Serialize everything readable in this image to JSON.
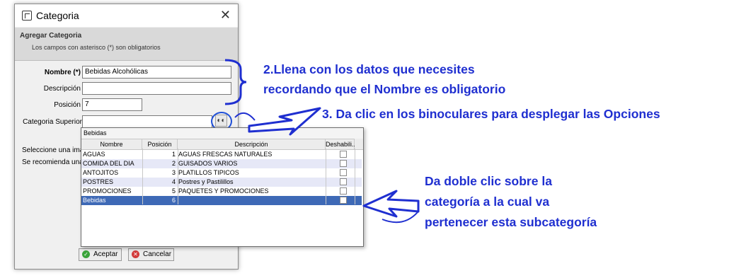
{
  "dialog": {
    "title": "Categoria",
    "close_glyph": "✕",
    "section_title": "Agregar Categoria",
    "section_sub": "Los campos con asterisco (*) son obligatorios",
    "fields": {
      "nombre_label": "Nombre (*)",
      "nombre_value": "Bebidas Alcohólicas",
      "descripcion_label": "Descripción",
      "descripcion_value": "",
      "posicion_label": "Posición",
      "posicion_value": "7",
      "categoria_label": "Categoria Superior",
      "categoria_value": ""
    },
    "side_text_1": "Seleccione una ima",
    "side_text_2": "Se recomienda una",
    "buttons": {
      "accept": "Aceptar",
      "cancel": "Cancelar"
    },
    "binoculars_icon": "binoculars-icon"
  },
  "popup": {
    "header": "Bebidas",
    "columns": [
      "Nombre",
      "Posición",
      "Descripción",
      "Deshabili..."
    ],
    "rows": [
      {
        "nombre": "AGUAS",
        "posicion": "1",
        "descripcion": "AGUAS FRESCAS NATURALES"
      },
      {
        "nombre": "COMIDA DEL DIA",
        "posicion": "2",
        "descripcion": "GUISADOS VARIOS"
      },
      {
        "nombre": "ANTOJITOS",
        "posicion": "3",
        "descripcion": "PLATILLOS TIPICOS"
      },
      {
        "nombre": "POSTRES",
        "posicion": "4",
        "descripcion": "Postres y Pastilillos"
      },
      {
        "nombre": "PROMOCIONES",
        "posicion": "5",
        "descripcion": "PAQUETES Y PROMOCIONES"
      },
      {
        "nombre": "Bebidas",
        "posicion": "6",
        "descripcion": ""
      }
    ]
  },
  "annotations": {
    "note_2_line1": "2.Llena con los datos que necesites",
    "note_2_line2": "recordando que el Nombre es obligatorio",
    "note_3": "3. Da clic en los binoculares para desplegar las Opciones",
    "note_4_line1": "Da doble clic sobre la",
    "note_4_line2": "categoría a la cual va",
    "note_4_line3": "pertenecer esta subcategoría",
    "color": "#1f2fd0"
  }
}
